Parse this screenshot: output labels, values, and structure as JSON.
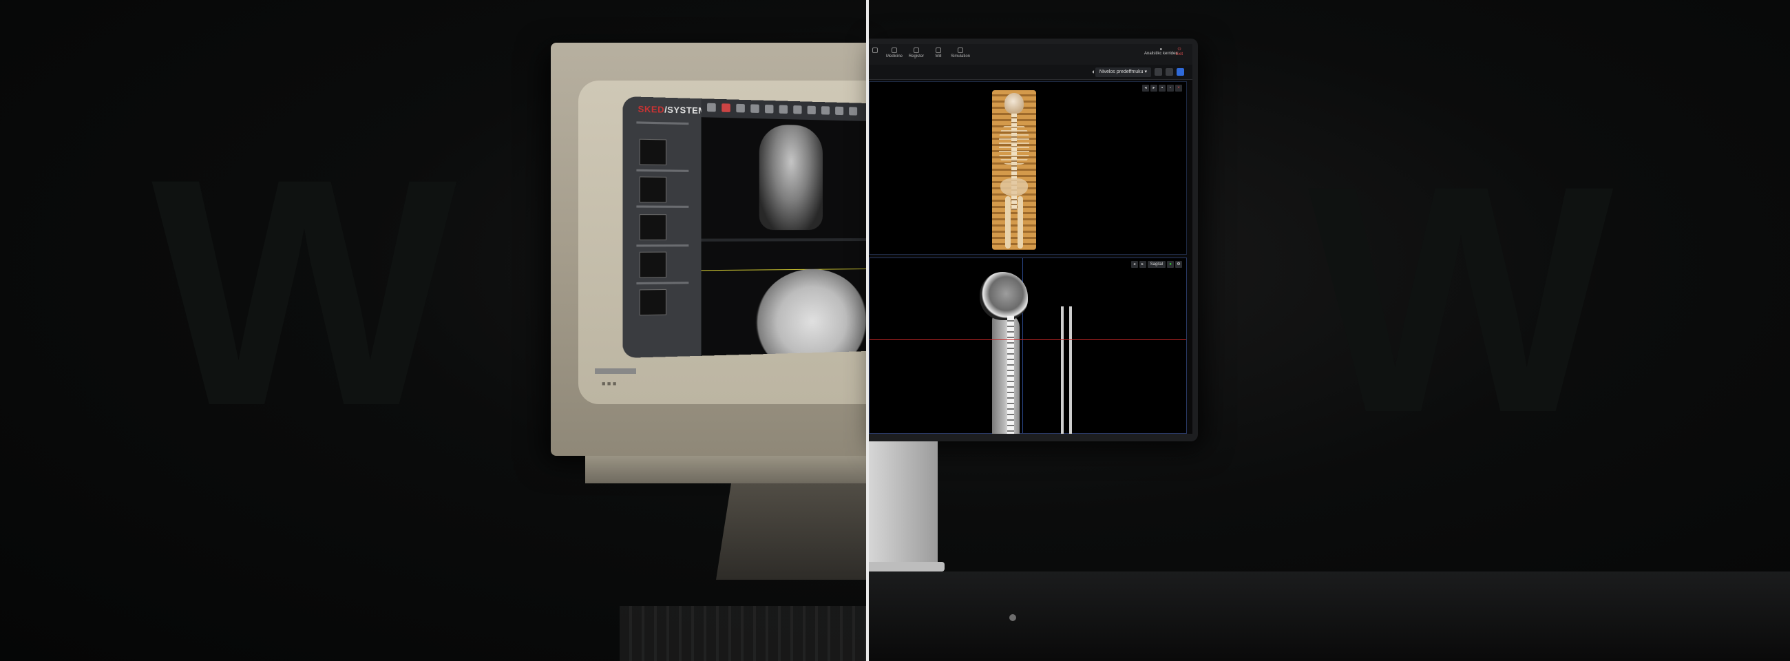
{
  "old_system": {
    "logo_prefix": "SKED",
    "logo_suffix": "/SYSTEM"
  },
  "new_system": {
    "topbar_items": [
      "",
      "Medicine",
      "Register",
      "Mill",
      "Simulation"
    ],
    "user_label": "Analistikc kerriden",
    "exit_label": "Exit",
    "layout_select": "Nivelos predeffmuku",
    "sagittal_label": "Sagital"
  },
  "colors": {
    "divider": "#e9e9e9",
    "crosshair_red": "#c52828",
    "crosshair_blue": "#3d66c9",
    "active_icon": "#2f6ad9",
    "exit": "#e05050"
  }
}
